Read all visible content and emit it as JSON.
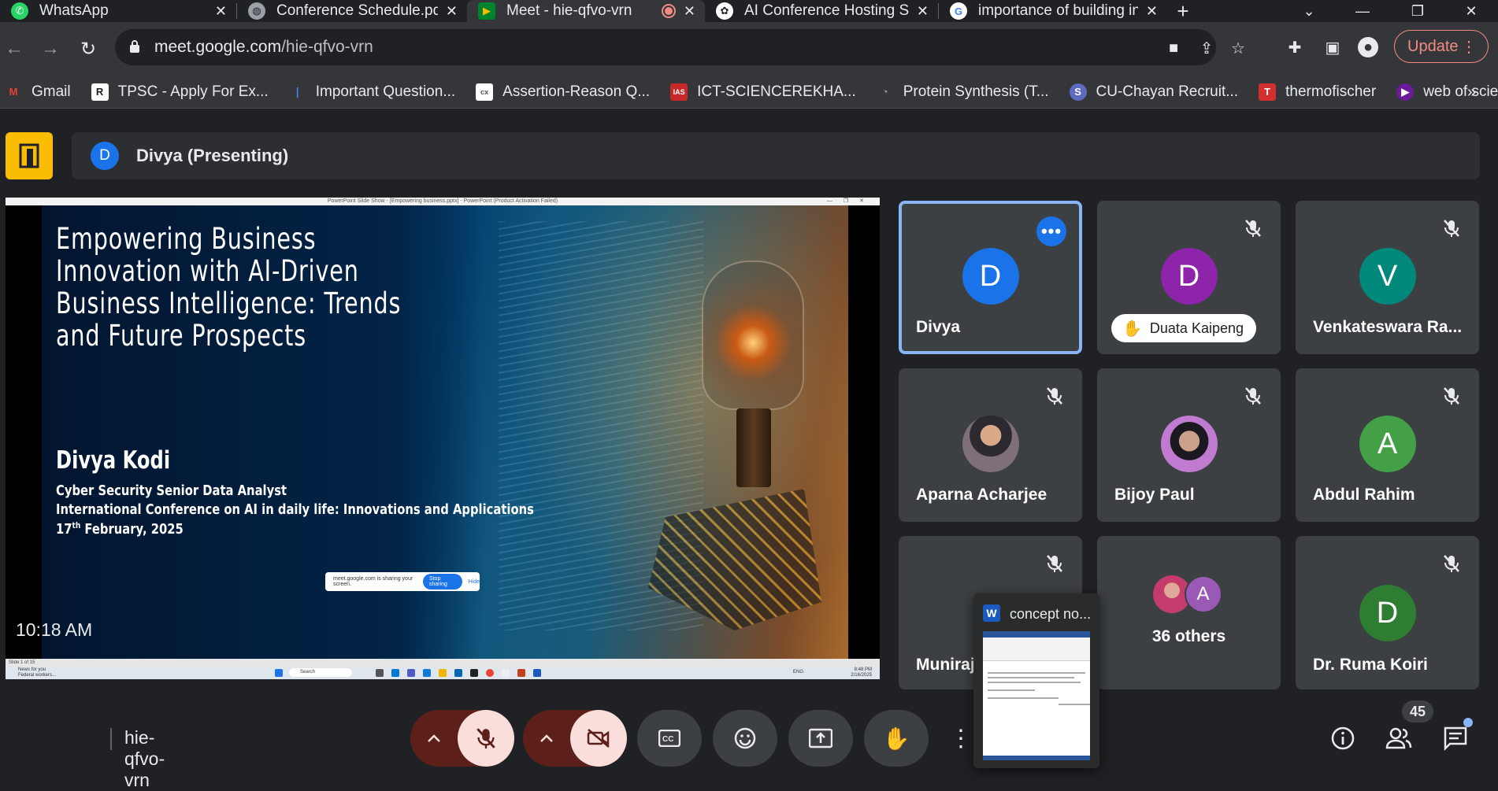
{
  "browser": {
    "tabs": [
      {
        "title": "WhatsApp",
        "icon": "whatsapp-icon",
        "active": false
      },
      {
        "title": "Conference Schedule.pdf",
        "icon": "globe-icon",
        "active": false
      },
      {
        "title": "Meet - hie-qfvo-vrn",
        "icon": "meet-icon",
        "active": true
      },
      {
        "title": "AI Conference Hosting Sp",
        "icon": "openai-icon",
        "active": false
      },
      {
        "title": "importance of building in",
        "icon": "google-icon",
        "active": false
      }
    ],
    "url_host": "meet.google.com",
    "url_path": "/hie-qfvo-vrn",
    "update_label": "Update",
    "bookmarks": [
      {
        "label": "Gmail",
        "icon": "gmail-icon"
      },
      {
        "label": "TPSC - Apply For Ex...",
        "icon": "tpsc-icon"
      },
      {
        "label": "Important Question...",
        "icon": "bookmark-icon"
      },
      {
        "label": "Assertion-Reason Q...",
        "icon": "cx12-icon"
      },
      {
        "label": "ICT-SCIENCEREKHA...",
        "icon": "ias-icon"
      },
      {
        "label": "Protein Synthesis (T...",
        "icon": "protein-icon"
      },
      {
        "label": "CU-Chayan Recruit...",
        "icon": "s-icon"
      },
      {
        "label": "thermofischer",
        "icon": "t-icon"
      },
      {
        "label": "web of science",
        "icon": "wos-icon"
      }
    ],
    "more_bookmarks": "»"
  },
  "meet": {
    "presenter_initial": "D",
    "presenter_label": "Divya (Presenting)",
    "clock": "10:18 AM",
    "meeting_code": "hie-qfvo-vrn",
    "participant_count": "45",
    "colors": {
      "accent": "#8ab4f8",
      "present_icon": "#fbbc04",
      "muted_red": "#f9dedc",
      "dark_red": "#5c1f1a"
    }
  },
  "slide": {
    "ppt_window_title": "PowerPoint Slide Show - [Empowering business.pptx] - PowerPoint (Product Activation Failed)",
    "title": "Empowering Business Innovation with  AI-Driven Business Intelligence: Trends and Future Prospects",
    "author": "Divya Kodi",
    "role": "Cyber Security Senior Data Analyst",
    "conference": "International Conference on AI in daily life: Innovations and Applications",
    "date_day": "17",
    "date_sup": "th",
    "date_rest": " February, 2025",
    "sharing_notice": "meet.google.com is sharing your screen.",
    "stop_sharing": "Stop sharing",
    "hide": "Hide",
    "slide_counter": "Slide 1 of 15",
    "news_line1": "News for you",
    "news_line2": "Federal workers...",
    "search": "Search",
    "tray_lang": "ENG",
    "tray_time": "8:48 PM",
    "tray_date": "2/16/2025"
  },
  "tiles": [
    {
      "name": "Divya",
      "initial": "D",
      "color": "#1a73e8"
    },
    {
      "name": "Duata Kaipeng",
      "initial": "D",
      "color": "#8e24aa"
    },
    {
      "name": "Venkateswara Ra...",
      "initial": "V",
      "color": "#00897b"
    },
    {
      "name": "Aparna Acharjee"
    },
    {
      "name": "Bijoy Paul"
    },
    {
      "name": "Abdul Rahim",
      "initial": "A",
      "color": "#43a047"
    },
    {
      "name": "Muniraj"
    },
    {
      "name": "36 others",
      "initial": "A"
    },
    {
      "name": "Dr. Ruma Koiri",
      "initial": "D",
      "color": "#2e7d32"
    }
  ],
  "thumbnail": {
    "title": "concept no...",
    "app_letter": "W"
  }
}
